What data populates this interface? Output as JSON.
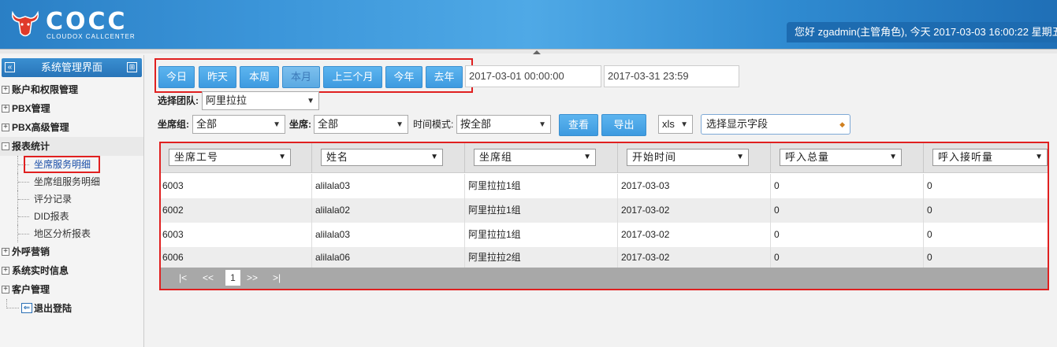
{
  "header": {
    "logo_text": "COCC",
    "logo_sub": "CLOUDOX CALLCENTER",
    "user_greeting": "您好 zgadmin(主管角色), 今天 2017-03-03 16:00:22 星期五"
  },
  "sidebar": {
    "title": "系统管理界面",
    "nodes": [
      {
        "label": "账户和权限管理",
        "state": "+"
      },
      {
        "label": "PBX管理",
        "state": "+"
      },
      {
        "label": "PBX高级管理",
        "state": "+"
      },
      {
        "label": "报表统计",
        "state": "-"
      }
    ],
    "report_children": [
      "坐席服务明细",
      "坐席组服务明细",
      "评分记录",
      "DID报表",
      "地区分析报表"
    ],
    "nodes_after": [
      {
        "label": "外呼营销",
        "state": "+"
      },
      {
        "label": "系统实时信息",
        "state": "+"
      },
      {
        "label": "客户管理",
        "state": "+"
      }
    ],
    "logout_label": "退出登陆"
  },
  "filters": {
    "quick_dates": [
      "今日",
      "昨天",
      "本周",
      "本月",
      "上三个月",
      "今年",
      "去年"
    ],
    "start_time": "2017-03-01 00:00:00",
    "end_time": "2017-03-31 23:59",
    "team_label": "选择团队:",
    "team_value": "阿里拉拉",
    "group_label": "坐席组:",
    "group_value": "全部",
    "agent_label": "坐席:",
    "agent_value": "全部",
    "time_mode_label": "时间模式:",
    "time_mode_value": "按全部",
    "view_button": "查看",
    "export_button": "导出",
    "format_value": "xls",
    "fields_value": "选择显示字段"
  },
  "table": {
    "columns": [
      "坐席工号",
      "姓名",
      "坐席组",
      "开始时间",
      "呼入总量",
      "呼入接听量"
    ],
    "rows": [
      [
        "6003",
        "alilala03",
        "阿里拉拉1组",
        "2017-03-03",
        "0",
        "0"
      ],
      [
        "6002",
        "alilala02",
        "阿里拉拉1组",
        "2017-03-02",
        "0",
        "0"
      ],
      [
        "6003",
        "alilala03",
        "阿里拉拉1组",
        "2017-03-02",
        "0",
        "0"
      ],
      [
        "6006",
        "alilala06",
        "阿里拉拉2组",
        "2017-03-02",
        "0",
        "0"
      ]
    ]
  },
  "pager": {
    "first": "|<",
    "prev": "<<",
    "current": "1",
    "next": ">>",
    "last": ">|"
  }
}
